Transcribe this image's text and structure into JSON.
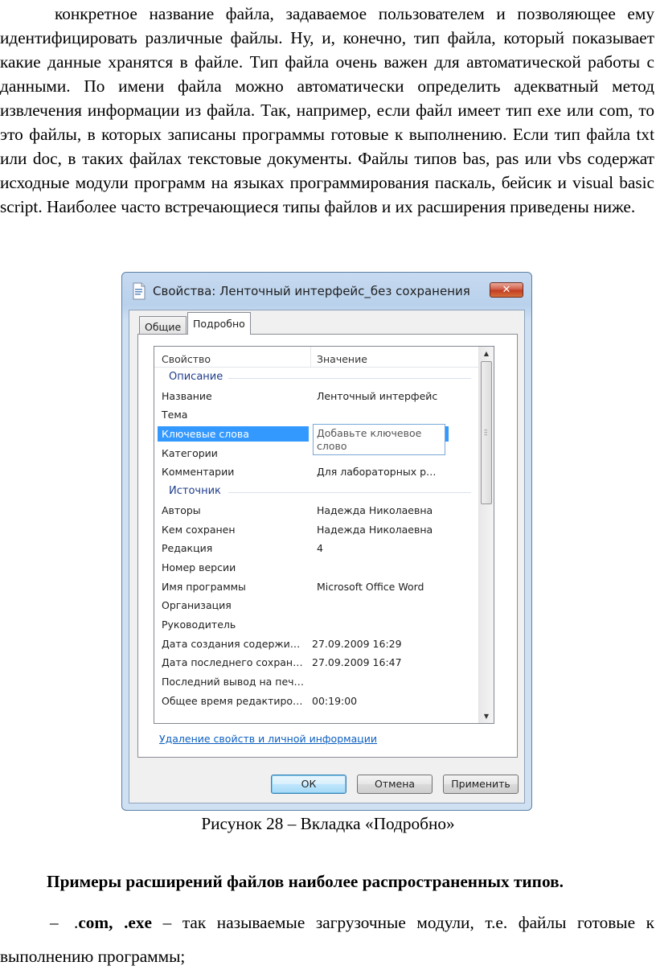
{
  "paragraph": "конкретное название файла, задаваемое пользователем и позволяющее ему идентифицировать различные файлы. Ну, и, конечно, тип файла, который показывает какие данные хранятся в файле. Тип файла очень важен для автоматической работы с данными. По имени файла можно автоматически определить адекватный метод извлечения информации из файла. Так, например, если файл имеет тип exe или com, то это файлы, в которых записаны программы готовые к выполнению. Если тип файла txt или doc, в таких файлах текстовые документы. Файлы типов bas, pas или vbs содержат исходные модули программ на языках программирования паскаль, бейсик и visual basic script. Наиболее часто встречающиеся типы файлов и их расширения приведены ниже.",
  "dialog": {
    "title": "Свойства: Ленточный интерфейс_без сохранения",
    "close_glyph": "✕",
    "tabs": [
      "Общие",
      "Подробно"
    ],
    "columns": {
      "property": "Свойство",
      "value": "Значение"
    },
    "groups": [
      {
        "name": "Описание",
        "rows": [
          {
            "property": "Название",
            "value": "Ленточный интерфейс"
          },
          {
            "property": "Тема",
            "value": ""
          },
          {
            "property": "Ключевые слова",
            "value": ""
          },
          {
            "property": "Категории",
            "value": ""
          },
          {
            "property": "Комментарии",
            "value": "Для лабораторных р…"
          }
        ]
      },
      {
        "name": "Источник",
        "rows": [
          {
            "property": "Авторы",
            "value": "Надежда Николаевна"
          },
          {
            "property": "Кем сохранен",
            "value": "Надежда Николаевна"
          },
          {
            "property": "Редакция",
            "value": "4"
          },
          {
            "property": "Номер версии",
            "value": ""
          },
          {
            "property": "Имя программы",
            "value": "Microsoft Office Word"
          },
          {
            "property": "Организация",
            "value": ""
          },
          {
            "property": "Руководитель",
            "value": ""
          },
          {
            "property": "Дата создания содержи…",
            "value": "27.09.2009 16:29"
          },
          {
            "property": "Дата последнего сохран…",
            "value": "27.09.2009 16:47"
          },
          {
            "property": "Последний вывод на печ…",
            "value": ""
          },
          {
            "property": "Общее время редактиро…",
            "value": "00:19:00"
          }
        ]
      }
    ],
    "keywords_placeholder": "Добавьте ключевое слово",
    "remove_link": "Удаление свойств и личной информации",
    "buttons": {
      "ok": "ОК",
      "cancel": "Отмена",
      "apply": "Применить"
    },
    "accent_color": "#3399ff"
  },
  "caption": "Рисунок 28 – Вкладка «Подробно»",
  "heading": "Примеры расширений файлов наиболее распространенных типов.",
  "bullet": {
    "dash": "–",
    "prefix": ".",
    "bold_part": "com, .exe",
    "rest": " – так называемые загрузочные модули, т.е. файлы готовые к выполнению программы;"
  }
}
